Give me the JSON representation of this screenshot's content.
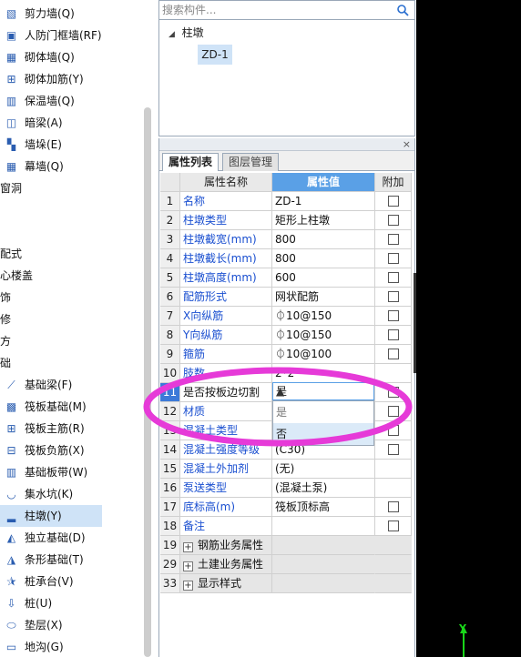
{
  "left_tree": {
    "items": [
      {
        "label": "剪力墙(Q)",
        "icon": "shear-wall-icon",
        "glyph": "▧",
        "indent": 1
      },
      {
        "label": "人防门框墙(RF)",
        "icon": "door-frame-wall-icon",
        "glyph": "▣",
        "indent": 1
      },
      {
        "label": "砌体墙(Q)",
        "icon": "masonry-wall-icon",
        "glyph": "▦",
        "indent": 1
      },
      {
        "label": "砌体加筋(Y)",
        "icon": "masonry-rebar-icon",
        "glyph": "⊞",
        "indent": 1
      },
      {
        "label": "保温墙(Q)",
        "icon": "insulation-wall-icon",
        "glyph": "▥",
        "indent": 1
      },
      {
        "label": "暗梁(A)",
        "icon": "hidden-beam-icon",
        "glyph": "◫",
        "indent": 1
      },
      {
        "label": "墙垛(E)",
        "icon": "wall-pier-icon",
        "glyph": "▚",
        "indent": 1
      },
      {
        "label": "幕墙(Q)",
        "icon": "curtain-wall-icon",
        "glyph": "▦",
        "indent": 1
      },
      {
        "label": "窗洞",
        "icon": "",
        "glyph": "",
        "indent": 0
      },
      {
        "label": "",
        "icon": "",
        "glyph": "",
        "indent": 0
      },
      {
        "label": "",
        "icon": "",
        "glyph": "",
        "indent": 0
      },
      {
        "label": "配式",
        "icon": "",
        "glyph": "",
        "indent": 0
      },
      {
        "label": "心楼盖",
        "icon": "",
        "glyph": "",
        "indent": 0
      },
      {
        "label": "饰",
        "icon": "",
        "glyph": "",
        "indent": 0
      },
      {
        "label": "修",
        "icon": "",
        "glyph": "",
        "indent": 0
      },
      {
        "label": "方",
        "icon": "",
        "glyph": "",
        "indent": 0
      },
      {
        "label": "础",
        "icon": "",
        "glyph": "",
        "indent": 0
      },
      {
        "label": "基础梁(F)",
        "icon": "foundation-beam-icon",
        "glyph": "⟋",
        "indent": 1
      },
      {
        "label": "筏板基础(M)",
        "icon": "raft-foundation-icon",
        "glyph": "▩",
        "indent": 1
      },
      {
        "label": "筏板主筋(R)",
        "icon": "raft-main-rebar-icon",
        "glyph": "⊞",
        "indent": 1
      },
      {
        "label": "筏板负筋(X)",
        "icon": "raft-negative-rebar-icon",
        "glyph": "⊟",
        "indent": 1
      },
      {
        "label": "基础板带(W)",
        "icon": "foundation-strip-icon",
        "glyph": "▥",
        "indent": 1
      },
      {
        "label": "集水坑(K)",
        "icon": "sump-pit-icon",
        "glyph": "◡",
        "indent": 1
      },
      {
        "label": "柱墩(Y)",
        "icon": "column-pier-icon",
        "glyph": "▂",
        "indent": 1,
        "selected": true
      },
      {
        "label": "独立基础(D)",
        "icon": "isolated-footing-icon",
        "glyph": "◭",
        "indent": 1
      },
      {
        "label": "条形基础(T)",
        "icon": "strip-footing-icon",
        "glyph": "◮",
        "indent": 1
      },
      {
        "label": "桩承台(V)",
        "icon": "pile-cap-icon",
        "glyph": "⯫",
        "indent": 1
      },
      {
        "label": "桩(U)",
        "icon": "pile-icon",
        "glyph": "⇩",
        "indent": 1
      },
      {
        "label": "垫层(X)",
        "icon": "cushion-layer-icon",
        "glyph": "⬭",
        "indent": 1
      },
      {
        "label": "地沟(G)",
        "icon": "ground-trench-icon",
        "glyph": "▭",
        "indent": 1
      }
    ]
  },
  "search": {
    "placeholder": "搜索构件..."
  },
  "component_tree": {
    "root": "柱墩",
    "leaf": "ZD-1"
  },
  "tabs": {
    "properties": "属性列表",
    "layers": "图层管理"
  },
  "grid": {
    "headers": {
      "name": "属性名称",
      "value": "属性值",
      "extra": "附加"
    },
    "rows": [
      {
        "no": "1",
        "name": "名称",
        "value": "ZD-1",
        "check": true
      },
      {
        "no": "2",
        "name": "柱墩类型",
        "value": "矩形上柱墩",
        "check": true
      },
      {
        "no": "3",
        "name": "柱墩截宽(mm)",
        "value": "800",
        "check": true
      },
      {
        "no": "4",
        "name": "柱墩截长(mm)",
        "value": "800",
        "check": true
      },
      {
        "no": "5",
        "name": "柱墩高度(mm)",
        "value": "600",
        "check": true
      },
      {
        "no": "6",
        "name": "配筋形式",
        "value": "网状配筋",
        "check": true
      },
      {
        "no": "7",
        "name": "X向纵筋",
        "value": "⏀10@150",
        "check": true
      },
      {
        "no": "8",
        "name": "Y向纵筋",
        "value": "⏀10@150",
        "check": true
      },
      {
        "no": "9",
        "name": "箍筋",
        "value": "⏀10@100",
        "check": true
      },
      {
        "no": "10",
        "name": "肢数",
        "value": "2*2",
        "check": false
      },
      {
        "no": "11",
        "name": "是否按板边切割",
        "value": "是",
        "check": true,
        "selected": true
      },
      {
        "no": "12",
        "name": "材质",
        "value": "",
        "check": true
      },
      {
        "no": "13",
        "name": "混凝土类型",
        "value": "",
        "check": true
      },
      {
        "no": "14",
        "name": "混凝土强度等级",
        "value": "(C30)",
        "check": true
      },
      {
        "no": "15",
        "name": "混凝土外加剂",
        "value": "(无)",
        "check": false
      },
      {
        "no": "16",
        "name": "泵送类型",
        "value": "(混凝土泵)",
        "check": false
      },
      {
        "no": "17",
        "name": "底标高(m)",
        "value": "筏板顶标高",
        "check": true
      },
      {
        "no": "18",
        "name": "备注",
        "value": "",
        "check": true
      },
      {
        "no": "19",
        "name": "钢筋业务属性",
        "value": "",
        "group": true
      },
      {
        "no": "29",
        "name": "土建业务属性",
        "value": "",
        "group": true
      },
      {
        "no": "33",
        "name": "显示样式",
        "value": "",
        "group": true
      }
    ]
  },
  "dropdown": {
    "value": "是",
    "options": [
      "是",
      "否"
    ]
  },
  "canvas": {
    "axis_label": "Y"
  },
  "colors": {
    "accent": "#5aa0e6",
    "selection": "#3c7ad8",
    "highlight": "#e63ad8"
  }
}
